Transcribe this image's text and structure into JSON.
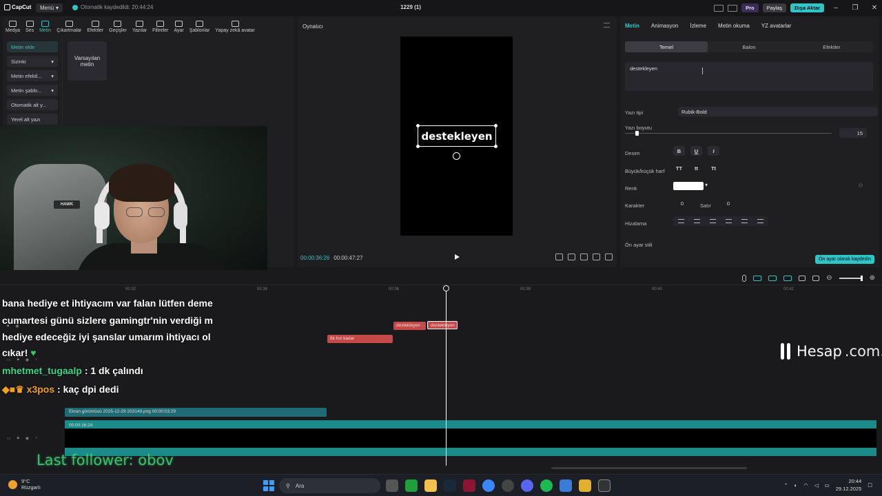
{
  "titlebar": {
    "logo": "CapCut",
    "menu_label": "Menü",
    "autosave_text": "Otomatik kaydedildi: 20:44:24",
    "project_title": "1229 (1)",
    "pro_label": "Pro",
    "share_label": "Paylaş",
    "export_label": "Dışa Aktar"
  },
  "toolbar": [
    {
      "label": "Medya"
    },
    {
      "label": "Ses"
    },
    {
      "label": "Metin"
    },
    {
      "label": "Çıkartmalar"
    },
    {
      "label": "Efektler"
    },
    {
      "label": "Geçişler"
    },
    {
      "label": "Yazılar"
    },
    {
      "label": "Filtreler"
    },
    {
      "label": "Ayar"
    },
    {
      "label": "Şablonlar"
    },
    {
      "label": "Yapay zekâ avatar"
    }
  ],
  "toolbar_active": "Metin",
  "left_nav": [
    {
      "label": "Metin ekle",
      "active": true
    },
    {
      "label": "Sizinki",
      "active": false
    },
    {
      "label": "Metin efektl...",
      "active": false
    },
    {
      "label": "Metin şablo...",
      "active": false
    },
    {
      "label": "Otomatik alt y...",
      "active": false
    },
    {
      "label": "Yerel alt yazı",
      "active": false
    }
  ],
  "default_text_card": "Varsayılan metin",
  "player": {
    "title": "Oynatıcı",
    "caption_text": "destekleyen",
    "current_time": "00:00:36:26",
    "total_time": "00:00:47:27"
  },
  "props": {
    "tabs": [
      "Metin",
      "Animasyon",
      "İzleme",
      "Metin okuma",
      "YZ avatarlar"
    ],
    "active_tab": "Metin",
    "subtabs": [
      "Temel",
      "Balon",
      "Efektler"
    ],
    "active_subtab": "Temel",
    "text_value": "destekleyen",
    "font_label": "Yazı tipi",
    "font_value": "Rubik-Bold",
    "size_label": "Yazı boyutu",
    "size_value": "15",
    "size_fraction": 0.05,
    "pattern_label": "Desen",
    "pattern_buttons": [
      "B",
      "U",
      "I"
    ],
    "case_label": "Büyük/küçük harf",
    "case_buttons": [
      "TT",
      "tt",
      "Tt"
    ],
    "color_label": "Renk",
    "color_value": "#ffffff",
    "char_label": "Karakter",
    "char_value": "0",
    "line_label": "Satır",
    "line_value": "0",
    "align_label": "Hizalama",
    "preset_label": "Ön ayar stili",
    "save_preset_label": "Ön ayar olarak kaydedin"
  },
  "timeline": {
    "ruler": [
      "00:32",
      "00:34",
      "00:36",
      "00:38",
      "00:40",
      "00:42"
    ],
    "clips_text": [
      {
        "label": "destekleyen",
        "selected": false
      },
      {
        "label": "destekleyen",
        "selected": true
      }
    ],
    "clip_red_label": "8k hız kadar",
    "media_clip_label": "Ekran görüntüsü 2025-12-29 203149.png  00:00:03:29",
    "main_track_label": "00:00:16:24"
  },
  "overlay": {
    "chat": [
      {
        "text": "bana hediye et ihtiyacım var falan lütfen deme"
      },
      {
        "text": "cumartesi günü sizlere gamingtr'nin verdiği m"
      },
      {
        "text": "hediye edeceğiz iyi şanslar umarım ihtiyacı ol"
      },
      {
        "text": "cıkar!"
      }
    ],
    "chat_msg1_user": "mhetmet_tugaalp",
    "chat_msg1_text": ": 1 dk çalındı",
    "chat_msg2_user": "x3pos",
    "chat_msg2_text": ": kaç dpi dedi",
    "last_follower": "Last follower: obov",
    "watermark": "Hesap",
    "watermark_suffix": ".com.tr",
    "chair_brand": "HAWK"
  },
  "taskbar": {
    "weather_temp": "9°C",
    "weather_desc": "Rüzgarlı",
    "search_placeholder": "Ara",
    "time": "20:44",
    "date": "29.12.2025"
  },
  "colors": {
    "accent": "#2fc5c5",
    "clip_red": "#c44a4a",
    "track_teal": "#1d8a8a"
  }
}
